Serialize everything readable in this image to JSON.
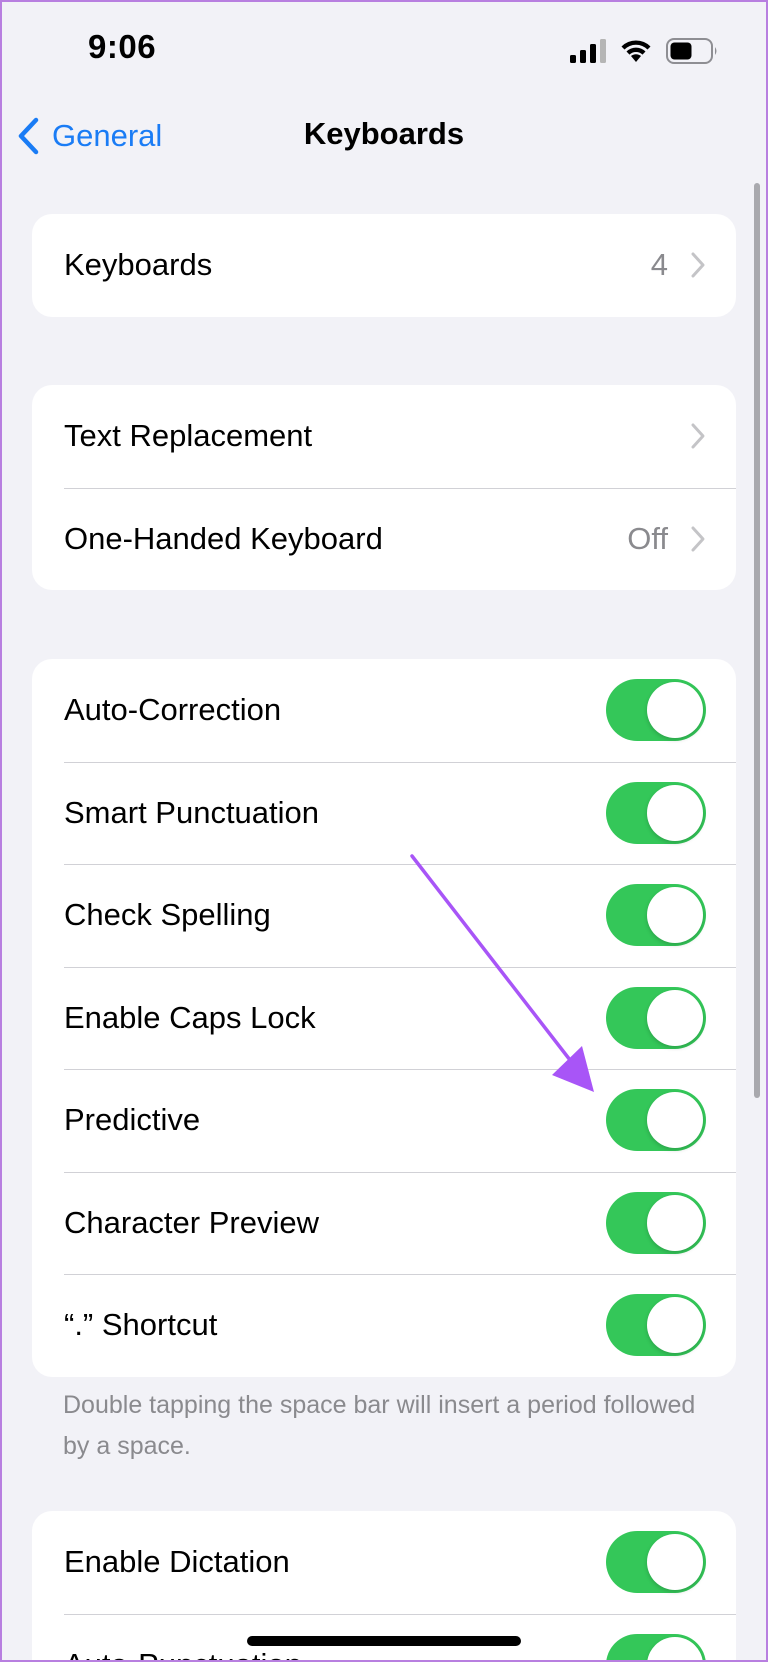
{
  "status_bar": {
    "time": "9:06"
  },
  "nav": {
    "back_label": "General",
    "title": "Keyboards"
  },
  "groups": {
    "keyboards": {
      "label": "Keyboards",
      "value": "4"
    },
    "text": {
      "text_replacement": {
        "label": "Text Replacement"
      },
      "one_handed": {
        "label": "One-Handed Keyboard",
        "value": "Off"
      }
    },
    "toggles": [
      {
        "label": "Auto-Correction",
        "on": true
      },
      {
        "label": "Smart Punctuation",
        "on": true
      },
      {
        "label": "Check Spelling",
        "on": true
      },
      {
        "label": "Enable Caps Lock",
        "on": true
      },
      {
        "label": "Predictive",
        "on": true
      },
      {
        "label": "Character Preview",
        "on": true
      },
      {
        "label": "“.” Shortcut",
        "on": true
      }
    ],
    "footer_note": "Double tapping the space bar will insert a period followed by a space.",
    "dictation": [
      {
        "label": "Enable Dictation",
        "on": true
      },
      {
        "label": "Auto-Punctuation",
        "on": true
      }
    ]
  },
  "colors": {
    "accent": "#1a7cf5",
    "toggle_on": "#34c759",
    "background": "#f2f2f7",
    "annotation_arrow": "#a855f7"
  },
  "icons": [
    "signal-icon",
    "wifi-icon",
    "battery-icon",
    "back-chevron-icon",
    "chevron-right-icon",
    "annotation-arrow"
  ]
}
